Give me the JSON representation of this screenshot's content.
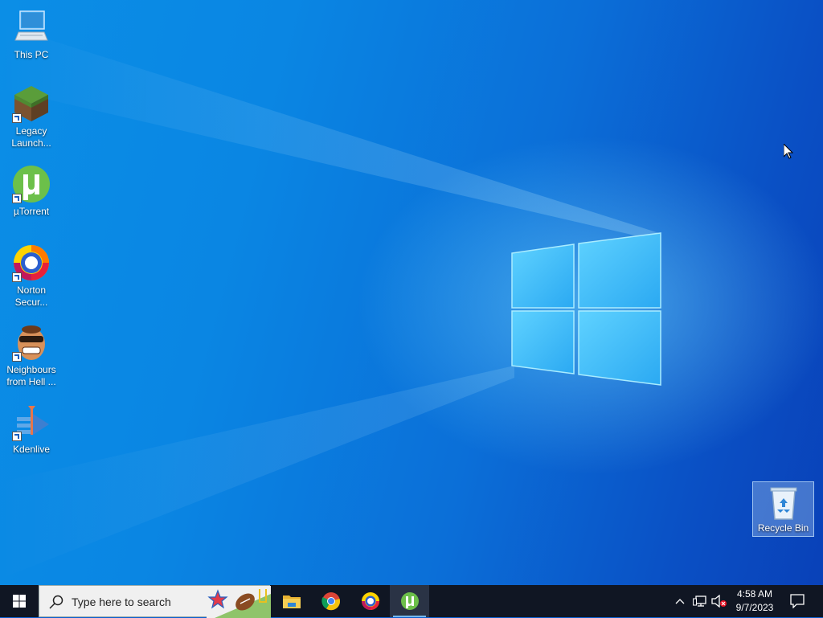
{
  "desktop": {
    "icons": [
      {
        "label": "This PC"
      },
      {
        "label": "Legacy\nLaunch..."
      },
      {
        "label": "µTorrent"
      },
      {
        "label": "Norton\nSecur..."
      },
      {
        "label": "Neighbours\nfrom Hell ..."
      },
      {
        "label": "Kdenlive"
      }
    ],
    "recycle_bin": {
      "label": "Recycle Bin"
    }
  },
  "taskbar": {
    "search_placeholder": "Type here to search",
    "pinned": [
      {
        "icon": "file-explorer-icon"
      },
      {
        "icon": "chrome-icon"
      },
      {
        "icon": "norton-icon"
      },
      {
        "icon": "utorrent-icon",
        "active": true
      }
    ],
    "tray": {
      "time": "4:58 AM",
      "date": "9/7/2023"
    }
  },
  "colors": {
    "taskbar_bg": "#101623",
    "accent": "#76b9ed"
  }
}
